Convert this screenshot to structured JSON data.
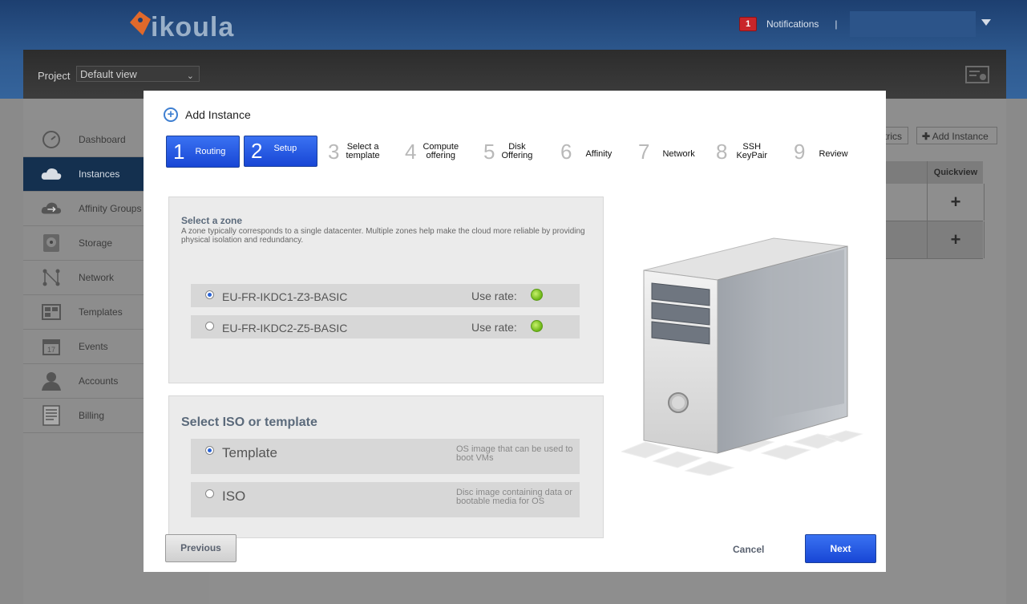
{
  "header": {
    "logo_text": "ikoula",
    "notifications_count": "1",
    "notifications_label": "Notifications",
    "separator": "|"
  },
  "project": {
    "label": "Project",
    "selected": "Default view"
  },
  "sidebar": {
    "items": [
      {
        "label": "Dashboard",
        "icon": "dashboard-icon"
      },
      {
        "label": "Instances",
        "icon": "cloud-icon",
        "active": true
      },
      {
        "label": "Affinity Groups",
        "icon": "affinity-groups-icon"
      },
      {
        "label": "Storage",
        "icon": "storage-icon"
      },
      {
        "label": "Network",
        "icon": "network-icon"
      },
      {
        "label": "Templates",
        "icon": "templates-icon"
      },
      {
        "label": "Events",
        "icon": "calendar-icon"
      },
      {
        "label": "Accounts",
        "icon": "user-icon"
      },
      {
        "label": "Billing",
        "icon": "billing-icon"
      }
    ]
  },
  "background": {
    "metrics_partial": "trics",
    "add_instance": "Add Instance",
    "quickview_header": "Quickview",
    "row_plus": "+"
  },
  "modal": {
    "title": "Add Instance",
    "steps": [
      {
        "num": "1",
        "label": "Routing",
        "active": true
      },
      {
        "num": "2",
        "label": "Setup",
        "active": true
      },
      {
        "num": "3",
        "label1": "Select a",
        "label2": "template"
      },
      {
        "num": "4",
        "label1": "Compute",
        "label2": "offering"
      },
      {
        "num": "5",
        "label1": "Disk",
        "label2": "Offering"
      },
      {
        "num": "6",
        "label": "Affinity"
      },
      {
        "num": "7",
        "label": "Network"
      },
      {
        "num": "8",
        "label1": "SSH",
        "label2": "KeyPair"
      },
      {
        "num": "9",
        "label": "Review"
      }
    ],
    "zone": {
      "title": "Select a zone",
      "description": "A zone typically corresponds to a single datacenter. Multiple zones help make the cloud more reliable by providing physical isolation and redundancy.",
      "options": [
        {
          "name": "EU-FR-IKDC1-Z3-BASIC",
          "use_rate_label": "Use rate:",
          "selected": true
        },
        {
          "name": "EU-FR-IKDC2-Z5-BASIC",
          "use_rate_label": "Use rate:",
          "selected": false
        }
      ]
    },
    "iso": {
      "title": "Select ISO or template",
      "options": [
        {
          "name": "Template",
          "description": "OS image that can be used to boot VMs",
          "selected": true
        },
        {
          "name": "ISO",
          "description": "Disc image containing data or bootable media for OS",
          "selected": false
        }
      ]
    },
    "buttons": {
      "previous": "Previous",
      "cancel": "Cancel",
      "next": "Next"
    }
  },
  "colors": {
    "header_blue": "#2f5b91",
    "accent_blue": "#1e52e0",
    "notification_red": "#c9252a",
    "use_rate_green": "#6bb514"
  }
}
